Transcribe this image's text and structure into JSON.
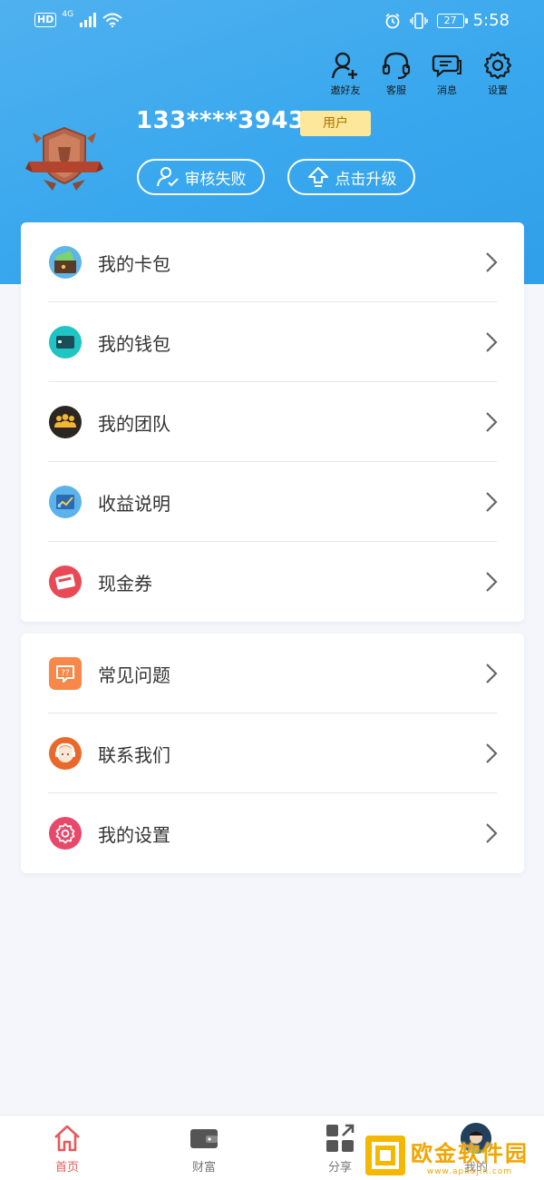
{
  "status_bar": {
    "hd": "HD",
    "network": "4G",
    "battery": "27",
    "time": "5:58"
  },
  "top_actions": [
    {
      "label": "邀好友",
      "icon": "add-user-icon"
    },
    {
      "label": "客服",
      "icon": "headset-icon"
    },
    {
      "label": "消息",
      "icon": "message-icon"
    },
    {
      "label": "设置",
      "icon": "gear-icon"
    }
  ],
  "profile": {
    "phone": "133****3943",
    "role": "用户",
    "review_status": "审核失败",
    "upgrade": "点击升级"
  },
  "menu_primary": [
    {
      "label": "我的卡包",
      "icon": "card-wallet-icon",
      "color": "#4aa3d6"
    },
    {
      "label": "我的钱包",
      "icon": "wallet-icon",
      "color": "#1fbfbf"
    },
    {
      "label": "我的团队",
      "icon": "team-icon",
      "color": "#2b2622"
    },
    {
      "label": "收益说明",
      "icon": "earnings-chart-icon",
      "color": "#4fa8e6"
    },
    {
      "label": "现金券",
      "icon": "coupon-icon",
      "color": "#e84a55"
    }
  ],
  "menu_secondary": [
    {
      "label": "常见问题",
      "icon": "faq-icon",
      "color": "#f7884a"
    },
    {
      "label": "联系我们",
      "icon": "customer-service-icon",
      "color": "#e86a2a"
    },
    {
      "label": "我的设置",
      "icon": "settings-icon",
      "color": "#e84a6a"
    }
  ],
  "bottom_nav": [
    {
      "label": "首页",
      "icon": "home-icon",
      "active": true
    },
    {
      "label": "财富",
      "icon": "wallet-icon"
    },
    {
      "label": "分享",
      "icon": "share-icon"
    },
    {
      "label": "我的",
      "icon": "avatar-icon"
    }
  ],
  "watermark": {
    "title": "欧金软件园",
    "url": "www.apoujin.com"
  },
  "colors": {
    "header": "#3aa9ee",
    "accent_red": "#e75a5a",
    "badge_yellow": "#fde79a"
  }
}
